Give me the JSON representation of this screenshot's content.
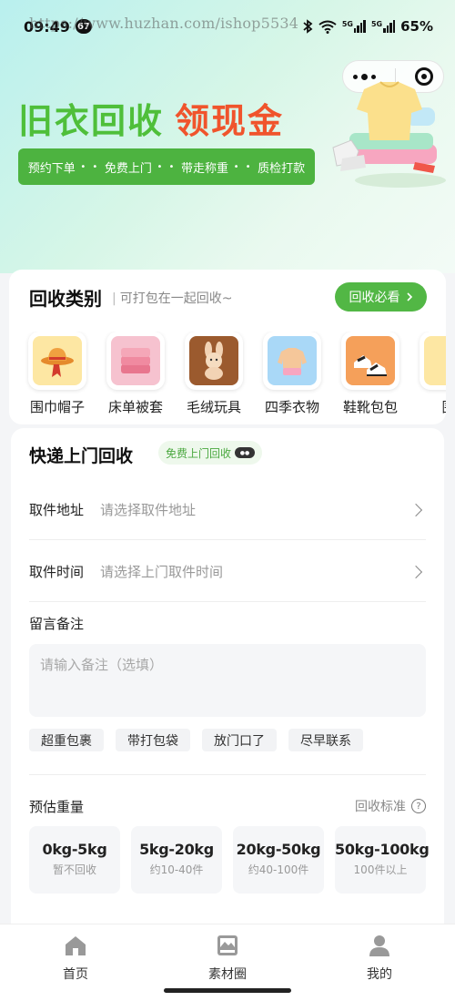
{
  "status_bar": {
    "time": "09:49",
    "notif_count": "67",
    "watermark": "https://www.huzhan.com/ishop5534",
    "net_1": "5G",
    "net_2": "5G",
    "battery": "65%"
  },
  "hero": {
    "title_green": "旧衣回收",
    "title_orange": "领现金",
    "steps": [
      "预约下单",
      "免费上门",
      "带走称重",
      "质检打款"
    ],
    "dots": "• •"
  },
  "category": {
    "title": "回收类别",
    "subtitle": "可打包在一起回收~",
    "must_see_label": "回收必看",
    "items": [
      {
        "label": "围巾帽子",
        "icon": "hat-scarf-icon",
        "color": "#f7c948"
      },
      {
        "label": "床单被套",
        "icon": "bedsheet-icon",
        "color": "#f08aa0"
      },
      {
        "label": "毛绒玩具",
        "icon": "plush-bunny-icon",
        "color": "#a86a3c"
      },
      {
        "label": "四季衣物",
        "icon": "sweater-icon",
        "color": "#9fd0f5"
      },
      {
        "label": "鞋靴包包",
        "icon": "sneakers-icon",
        "color": "#f08a3c"
      },
      {
        "label": "围",
        "icon": "more-item-icon",
        "color": "#f7c948"
      }
    ]
  },
  "express": {
    "title": "快递上门回收",
    "free_badge": "免费上门回收",
    "address_label": "取件地址",
    "address_placeholder": "请选择取件地址",
    "time_label": "取件时间",
    "time_placeholder": "请选择上门取件时间",
    "note_label": "留言备注",
    "note_placeholder": "请输入备注（选填）",
    "tags": [
      "超重包裹",
      "带打包袋",
      "放门口了",
      "尽早联系"
    ],
    "weight_label": "预估重量",
    "standard_label": "回收标准",
    "weights": [
      {
        "range": "0kg-5kg",
        "desc": "暂不回收"
      },
      {
        "range": "5kg-20kg",
        "desc": "约10-40件"
      },
      {
        "range": "20kg-50kg",
        "desc": "约40-100件"
      },
      {
        "range": "50kg-100kg",
        "desc": "100件以上"
      }
    ]
  },
  "tab_bar": {
    "home": "首页",
    "material": "素材圈",
    "mine": "我的"
  }
}
